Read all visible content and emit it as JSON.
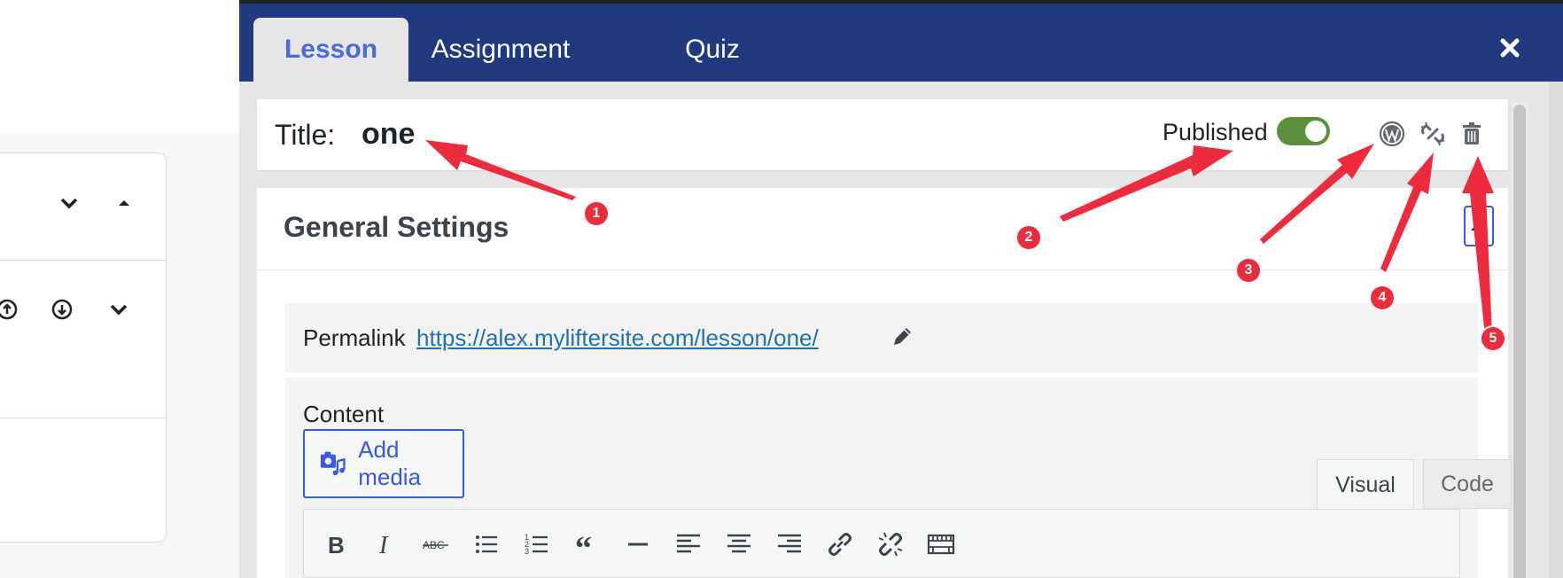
{
  "tabs": [
    {
      "label": "Lesson",
      "active": true
    },
    {
      "label": "Assignment",
      "active": false
    },
    {
      "label": "Quiz",
      "active": false
    }
  ],
  "close_icon": "close-icon",
  "title_bar": {
    "label": "Title:",
    "value": "one",
    "status_label": "Published",
    "published": true,
    "icons": [
      "wordpress-icon",
      "unlink-icon",
      "trash-icon"
    ]
  },
  "general_settings": {
    "heading": "General Settings",
    "permalink_label": "Permalink",
    "permalink_url": "https://alex.myliftersite.com/lesson/one/",
    "content_label": "Content",
    "add_media_label": "Add media",
    "editor_tabs": {
      "visual": "Visual",
      "code": "Code"
    },
    "toolbar_icons": [
      "bold-icon",
      "italic-icon",
      "strikethrough-icon",
      "bullet-list-icon",
      "numbered-list-icon",
      "blockquote-icon",
      "horizontal-rule-icon",
      "align-left-icon",
      "align-center-icon",
      "align-right-icon",
      "link-icon",
      "unlink-icon",
      "toolbar-toggle-icon"
    ]
  },
  "annotations": {
    "badges": [
      "1",
      "2",
      "3",
      "4",
      "5"
    ]
  },
  "colors": {
    "header": "#22387f",
    "active_tab_text": "#466dd8",
    "toggle_on": "#5b8f3b",
    "annotation": "#ee2a3d",
    "link": "#2271b1"
  }
}
